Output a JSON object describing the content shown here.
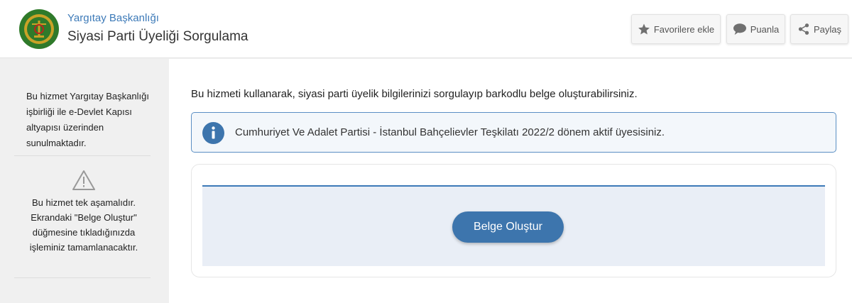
{
  "header": {
    "org_name": "Yargıtay Başkanlığı",
    "page_title": "Siyasi Parti Üyeliği Sorgulama",
    "logo_icon": "yargitay-seal-icon",
    "buttons": [
      {
        "label": "Favorilere ekle",
        "icon": "star-icon"
      },
      {
        "label": "Puanla",
        "icon": "speech-bubble-icon"
      },
      {
        "label": "Paylaş",
        "icon": "share-icon"
      }
    ]
  },
  "sidebar": {
    "service_info": "Bu hizmet Yargıtay Başkanlığı işbirliği ile e-Devlet Kapısı altyapısı üzerinden sunulmaktadır.",
    "warning_icon": "warning-triangle-icon",
    "step_info": "Bu hizmet tek aşamalıdır. Ekrandaki \"Belge Oluştur\" düğmesine tıkladığınızda işleminiz tamamlanacaktır."
  },
  "main": {
    "intro": "Bu hizmeti kullanarak, siyasi parti üyelik bilgilerinizi sorgulayıp barkodlu belge oluşturabilirsiniz.",
    "info_icon": "info-icon",
    "info_message": "Cumhuriyet Ve Adalet Partisi - İstanbul Bahçelievler Teşkilatı 2022/2 dönem aktif üyesisiniz.",
    "create_button": "Belge Oluştur"
  },
  "colors": {
    "accent": "#3d7ab8",
    "button": "#3d75ad",
    "info_bg": "#f3f7fb",
    "panel_bg": "#e9eef6",
    "sidebar_bg": "#f0f0f0"
  }
}
